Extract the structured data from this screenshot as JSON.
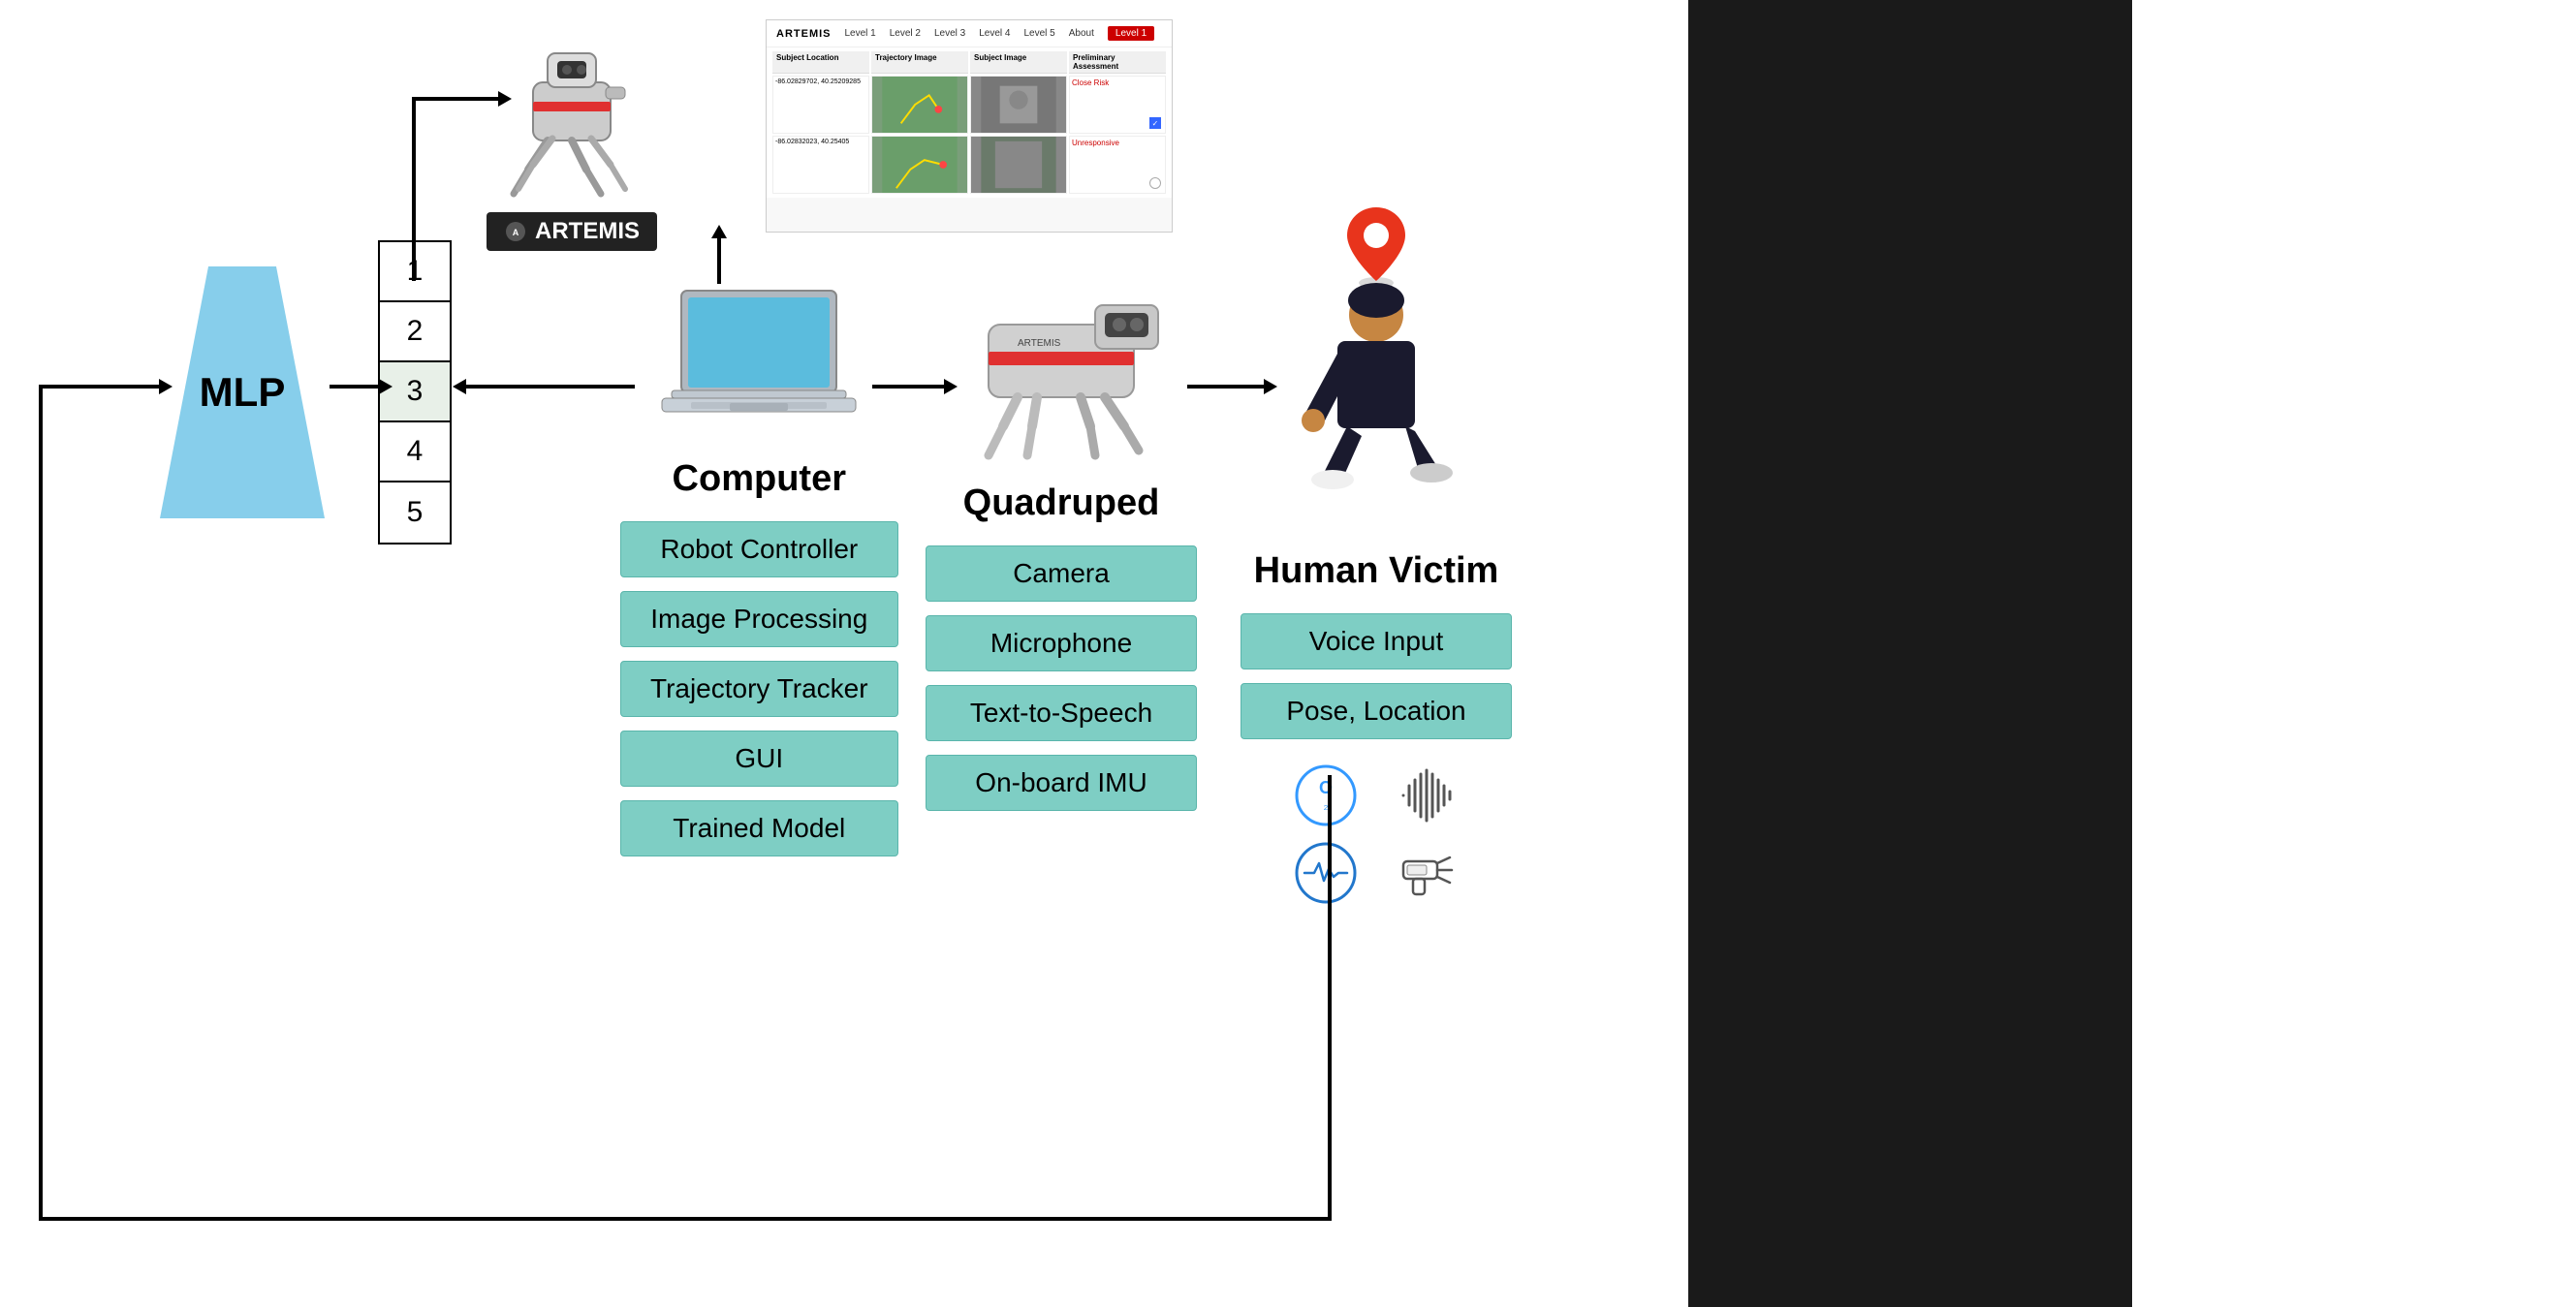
{
  "mlp": {
    "label": "MLP"
  },
  "numbered_list": {
    "items": [
      "1",
      "2",
      "3",
      "4",
      "5"
    ]
  },
  "computer": {
    "label": "Computer",
    "features": [
      "Robot Controller",
      "Image Processing",
      "Trajectory Tracker",
      "GUI",
      "Trained Model"
    ]
  },
  "quadruped": {
    "label": "Quadruped",
    "features": [
      "Camera",
      "Microphone",
      "Text-to-Speech",
      "On-board IMU"
    ]
  },
  "human_victim": {
    "label": "Human Victim",
    "features": [
      "Voice Input",
      "Pose, Location"
    ]
  },
  "artemis": {
    "badge": "ARTEMIS"
  },
  "web": {
    "logo": "ARTEMIS",
    "nav": [
      "Level 1",
      "Level 2",
      "Level 3",
      "Level 4",
      "Level 5",
      "About"
    ],
    "active": "Level 1"
  },
  "colors": {
    "feature_box_bg": "#7ecec4",
    "mlp_bg": "#87ceeb",
    "arrow": "#000",
    "pin_red": "#e8341c",
    "pin_green": "#33cc33"
  }
}
